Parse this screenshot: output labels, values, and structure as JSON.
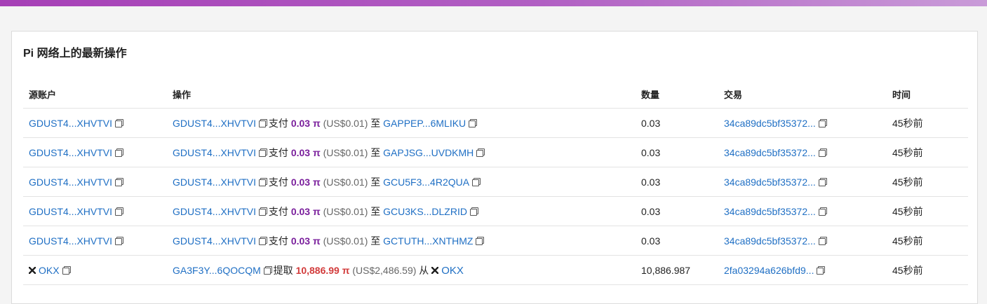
{
  "panel": {
    "title": "Pi 网络上的最新操作"
  },
  "columns": {
    "source": "源账户",
    "operation": "操作",
    "quantity": "数量",
    "transaction": "交易",
    "time": "时间"
  },
  "rows": [
    {
      "source": "GDUST4...XHVTVI",
      "op_from": "GDUST4...XHVTVI",
      "op_verb": "支付",
      "amount": "0.03 π",
      "usd": "(US$0.01)",
      "op_prep": "至",
      "op_to": "GAPPEP...6MLIKU",
      "quantity": "0.03",
      "tx": "34ca89dc5bf35372...",
      "time": "45秒前"
    },
    {
      "source": "GDUST4...XHVTVI",
      "op_from": "GDUST4...XHVTVI",
      "op_verb": "支付",
      "amount": "0.03 π",
      "usd": "(US$0.01)",
      "op_prep": "至",
      "op_to": "GAPJSG...UVDKMH",
      "quantity": "0.03",
      "tx": "34ca89dc5bf35372...",
      "time": "45秒前"
    },
    {
      "source": "GDUST4...XHVTVI",
      "op_from": "GDUST4...XHVTVI",
      "op_verb": "支付",
      "amount": "0.03 π",
      "usd": "(US$0.01)",
      "op_prep": "至",
      "op_to": "GCU5F3...4R2QUA",
      "quantity": "0.03",
      "tx": "34ca89dc5bf35372...",
      "time": "45秒前"
    },
    {
      "source": "GDUST4...XHVTVI",
      "op_from": "GDUST4...XHVTVI",
      "op_verb": "支付",
      "amount": "0.03 π",
      "usd": "(US$0.01)",
      "op_prep": "至",
      "op_to": "GCU3KS...DLZRID",
      "quantity": "0.03",
      "tx": "34ca89dc5bf35372...",
      "time": "45秒前"
    },
    {
      "source": "GDUST4...XHVTVI",
      "op_from": "GDUST4...XHVTVI",
      "op_verb": "支付",
      "amount": "0.03 π",
      "usd": "(US$0.01)",
      "op_prep": "至",
      "op_to": "GCTUTH...XNTHMZ",
      "quantity": "0.03",
      "tx": "34ca89dc5bf35372...",
      "time": "45秒前"
    }
  ],
  "withdraw_row": {
    "source": "OKX",
    "source_icon": "okx-icon",
    "op_from": "GA3F3Y...6QOCQM",
    "op_verb": "提取",
    "amount": "10,886.99 π",
    "usd": "(US$2,486.59)",
    "op_prep": "从",
    "op_to": "OKX",
    "op_to_icon": "okx-icon",
    "quantity": "10,886.987",
    "tx": "2fa03294a626bfd9...",
    "time": "45秒前"
  },
  "colors": {
    "link": "#1f6fc4",
    "pay_amount": "#7a1f9c",
    "withdraw_amount": "#d23b3b",
    "topbar": "#a63fb6"
  }
}
